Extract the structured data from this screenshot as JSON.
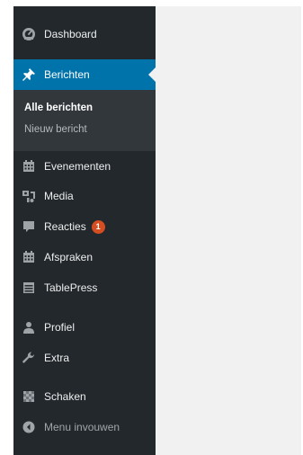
{
  "sidebar": {
    "items": [
      {
        "label": "Dashboard",
        "icon": "dashboard-icon"
      },
      {
        "label": "Berichten",
        "icon": "pin-icon",
        "active": true
      },
      {
        "label": "Evenementen",
        "icon": "calendar-icon"
      },
      {
        "label": "Media",
        "icon": "media-icon"
      },
      {
        "label": "Reacties",
        "icon": "comment-icon",
        "badge": "1"
      },
      {
        "label": "Afspraken",
        "icon": "calendar-icon"
      },
      {
        "label": "TablePress",
        "icon": "table-icon"
      },
      {
        "label": "Profiel",
        "icon": "user-icon"
      },
      {
        "label": "Extra",
        "icon": "wrench-icon"
      },
      {
        "label": "Schaken",
        "icon": "chessboard-icon"
      }
    ],
    "submenu": [
      {
        "label": "Alle berichten",
        "current": true
      },
      {
        "label": "Nieuw bericht"
      }
    ],
    "collapse_label": "Menu invouwen"
  },
  "colors": {
    "sidebar_bg": "#23282d",
    "submenu_bg": "#32373c",
    "active_bg": "#0073aa",
    "badge_bg": "#d54e21",
    "content_bg": "#f1f1f1"
  }
}
